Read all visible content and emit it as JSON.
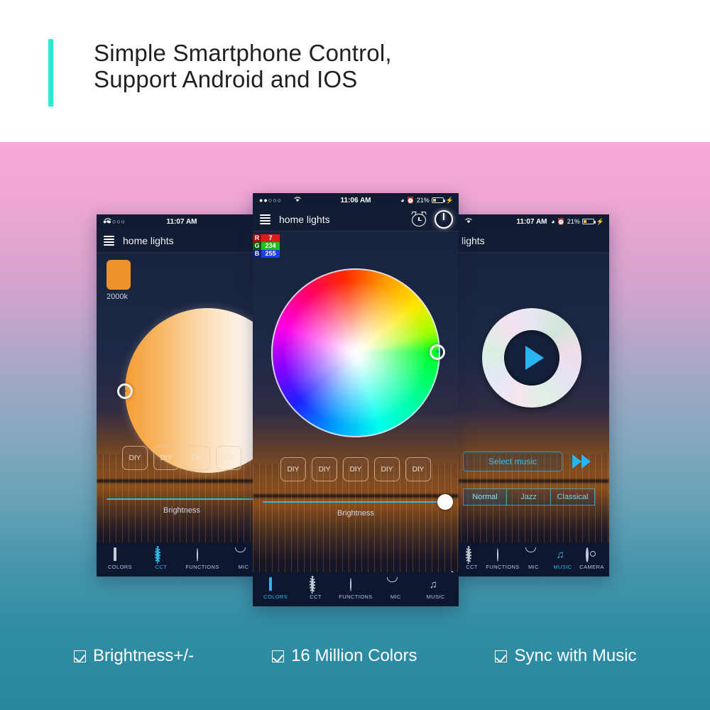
{
  "header": {
    "line1": "Simple Smartphone Control,",
    "line2": "Support Android and IOS",
    "accent_color": "#2ee8d5"
  },
  "background": {
    "top_color": "#f7a9d9",
    "bottom_color": "#28869e"
  },
  "phones": [
    {
      "id": "phone-left",
      "screen": "cct",
      "statusbar": {
        "signal_dots": "●●○○○",
        "wifi": "wifi-icon",
        "time": "11:07 AM",
        "battery_percent": "",
        "battery_icon": "battery-icon"
      },
      "appbar": {
        "title": "home lights",
        "menu_icon": "hamburger-menu-icon"
      },
      "cct": {
        "swatch_color": "#f0922a",
        "kelvin_label": "2000k"
      },
      "diy_buttons": [
        "DIY",
        "DIY",
        "DIY",
        "DIY"
      ],
      "slider": {
        "label": "Brightness",
        "value": 100
      },
      "nav": [
        {
          "label": "COLORS",
          "icon": "rainbow-icon",
          "active": false
        },
        {
          "label": "CCT",
          "icon": "sun-icon",
          "active": true
        },
        {
          "label": "FUNCTIONS",
          "icon": "hatched-circle-icon",
          "active": false
        },
        {
          "label": "MIC",
          "icon": "microphone-icon",
          "active": false
        }
      ]
    },
    {
      "id": "phone-mid",
      "screen": "colors",
      "statusbar": {
        "signal_dots": "●●○○○",
        "wifi": "wifi-icon",
        "time": "11:06 AM",
        "battery_percent": "21%",
        "battery_icon": "battery-icon"
      },
      "appbar": {
        "title": "home lights",
        "menu_icon": "hamburger-menu-icon",
        "alarm_icon": "alarm-clock-icon",
        "power_icon": "power-button-icon"
      },
      "rgb": {
        "r_label": "R",
        "r_value": "7",
        "g_label": "G",
        "g_value": "234",
        "b_label": "B",
        "b_value": "255"
      },
      "diy_buttons": [
        "DIY",
        "DIY",
        "DIY",
        "DIY",
        "DIY"
      ],
      "slider": {
        "label": "Brightness",
        "value": 100
      },
      "nav": [
        {
          "label": "COLORS",
          "icon": "rainbow-icon",
          "active": true
        },
        {
          "label": "CCT",
          "icon": "sun-icon",
          "active": false
        },
        {
          "label": "FUNCTIONS",
          "icon": "hatched-circle-icon",
          "active": false
        },
        {
          "label": "MIC",
          "icon": "microphone-icon",
          "active": false
        },
        {
          "label": "MUSIC",
          "icon": "music-note-icon",
          "active": false
        }
      ],
      "secondary_nav_label": "MUSIC"
    },
    {
      "id": "phone-right",
      "screen": "music",
      "statusbar": {
        "wifi": "wifi-icon",
        "time": "11:07 AM",
        "battery_percent": "21%",
        "battery_icon": "battery-icon"
      },
      "appbar": {
        "title": "lights"
      },
      "music": {
        "disc_icon": "cd-disc-icon",
        "play_icon": "play-triangle-icon",
        "select_music_label": "Select music",
        "forward_icon": "fast-forward-icon",
        "genres": [
          {
            "label": "Normal",
            "active": true
          },
          {
            "label": "Jazz",
            "active": false
          },
          {
            "label": "Classical",
            "active": false
          }
        ]
      },
      "nav": [
        {
          "label": "CCT",
          "icon": "sun-icon",
          "active": false
        },
        {
          "label": "FUNCTIONS",
          "icon": "hatched-circle-icon",
          "active": false
        },
        {
          "label": "MIC",
          "icon": "microphone-icon",
          "active": false
        },
        {
          "label": "MUSIC",
          "icon": "music-note-icon",
          "active": true
        },
        {
          "label": "CAMERA",
          "icon": "camera-icon",
          "active": false
        }
      ]
    }
  ],
  "features": [
    {
      "label": "Brightness+/-",
      "icon": "checkbox-checked-icon"
    },
    {
      "label": "16 Million Colors",
      "icon": "checkbox-checked-icon"
    },
    {
      "label": "Sync with Music",
      "icon": "checkbox-checked-icon"
    }
  ]
}
